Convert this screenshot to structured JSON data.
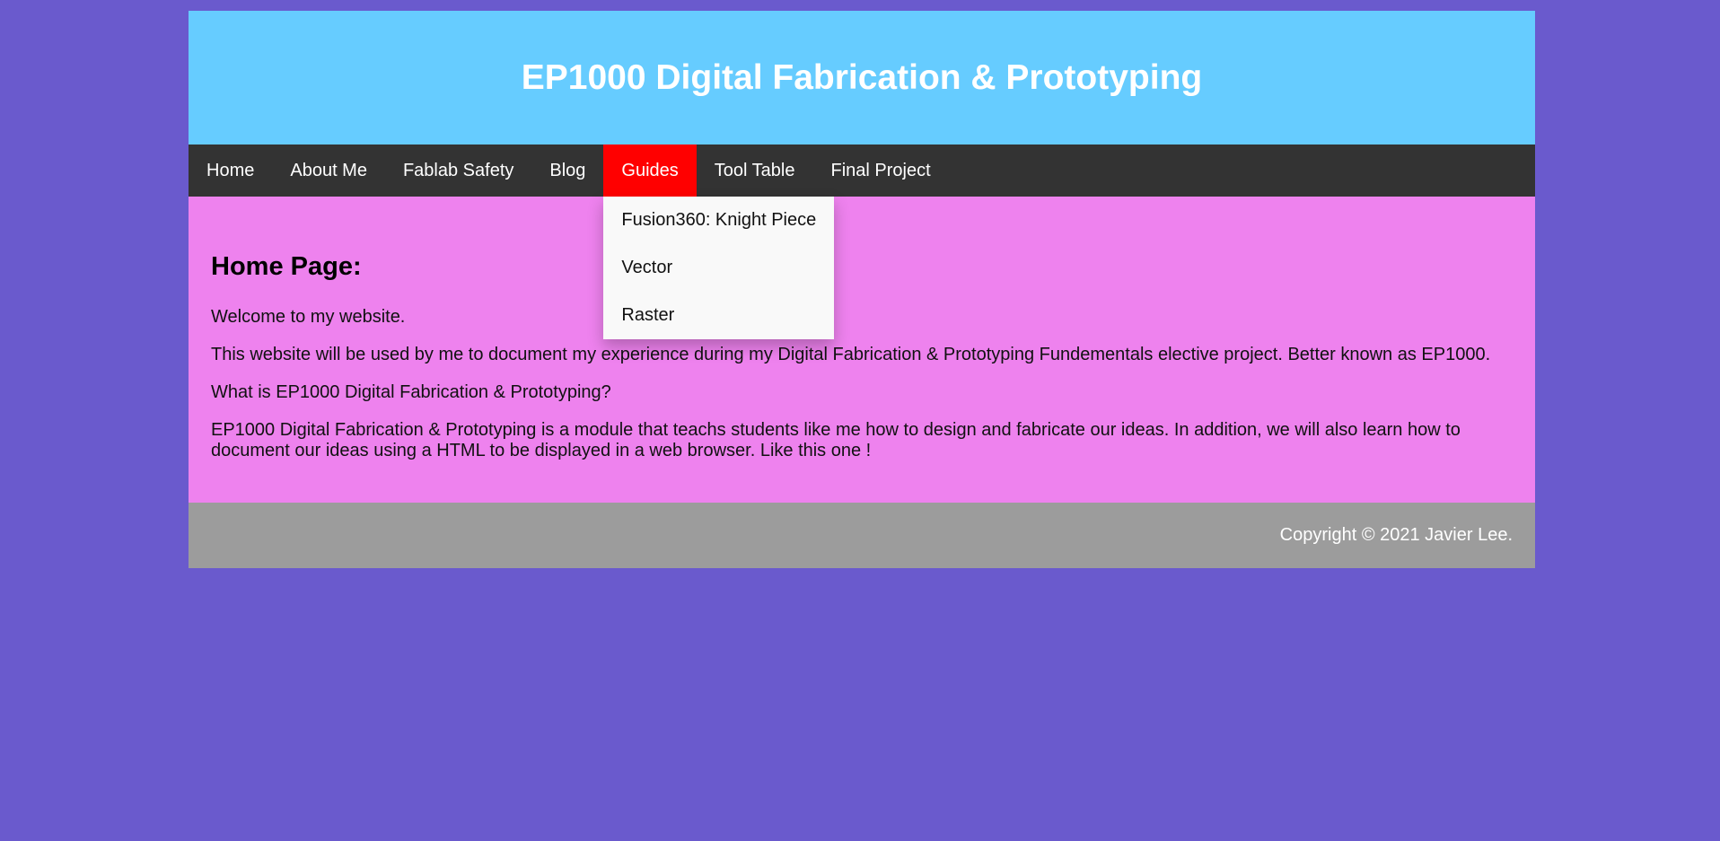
{
  "header": {
    "title": "EP1000 Digital Fabrication & Prototyping"
  },
  "nav": {
    "items": [
      {
        "label": "Home"
      },
      {
        "label": "About Me"
      },
      {
        "label": "Fablab Safety"
      },
      {
        "label": "Blog"
      },
      {
        "label": "Guides",
        "active": true
      },
      {
        "label": "Tool Table"
      },
      {
        "label": "Final Project"
      }
    ],
    "dropdown": {
      "items": [
        {
          "label": "Fusion360: Knight Piece"
        },
        {
          "label": "Vector"
        },
        {
          "label": "Raster"
        }
      ]
    }
  },
  "main": {
    "heading": "Home Page:",
    "paragraphs": [
      "Welcome to my website.",
      "This website will be used by me to document my experience during my Digital Fabrication & Prototyping Fundementals elective project. Better known as EP1000.",
      "What is EP1000 Digital Fabrication & Prototyping?",
      "EP1000 Digital Fabrication & Prototyping is a module that teachs students like me how to design and fabricate our ideas. In addition, we will also learn how to document our ideas using a HTML to be displayed in a web browser. Like this one !"
    ]
  },
  "footer": {
    "copyright": "Copyright © 2021 Javier Lee."
  },
  "colors": {
    "page_background": "#6a5acd",
    "header_background": "#66ccff",
    "nav_background": "#333333",
    "nav_active": "#ff0000",
    "dropdown_background": "#f9f9f9",
    "main_background": "#ee82ee",
    "footer_background": "#9c9c9c"
  }
}
